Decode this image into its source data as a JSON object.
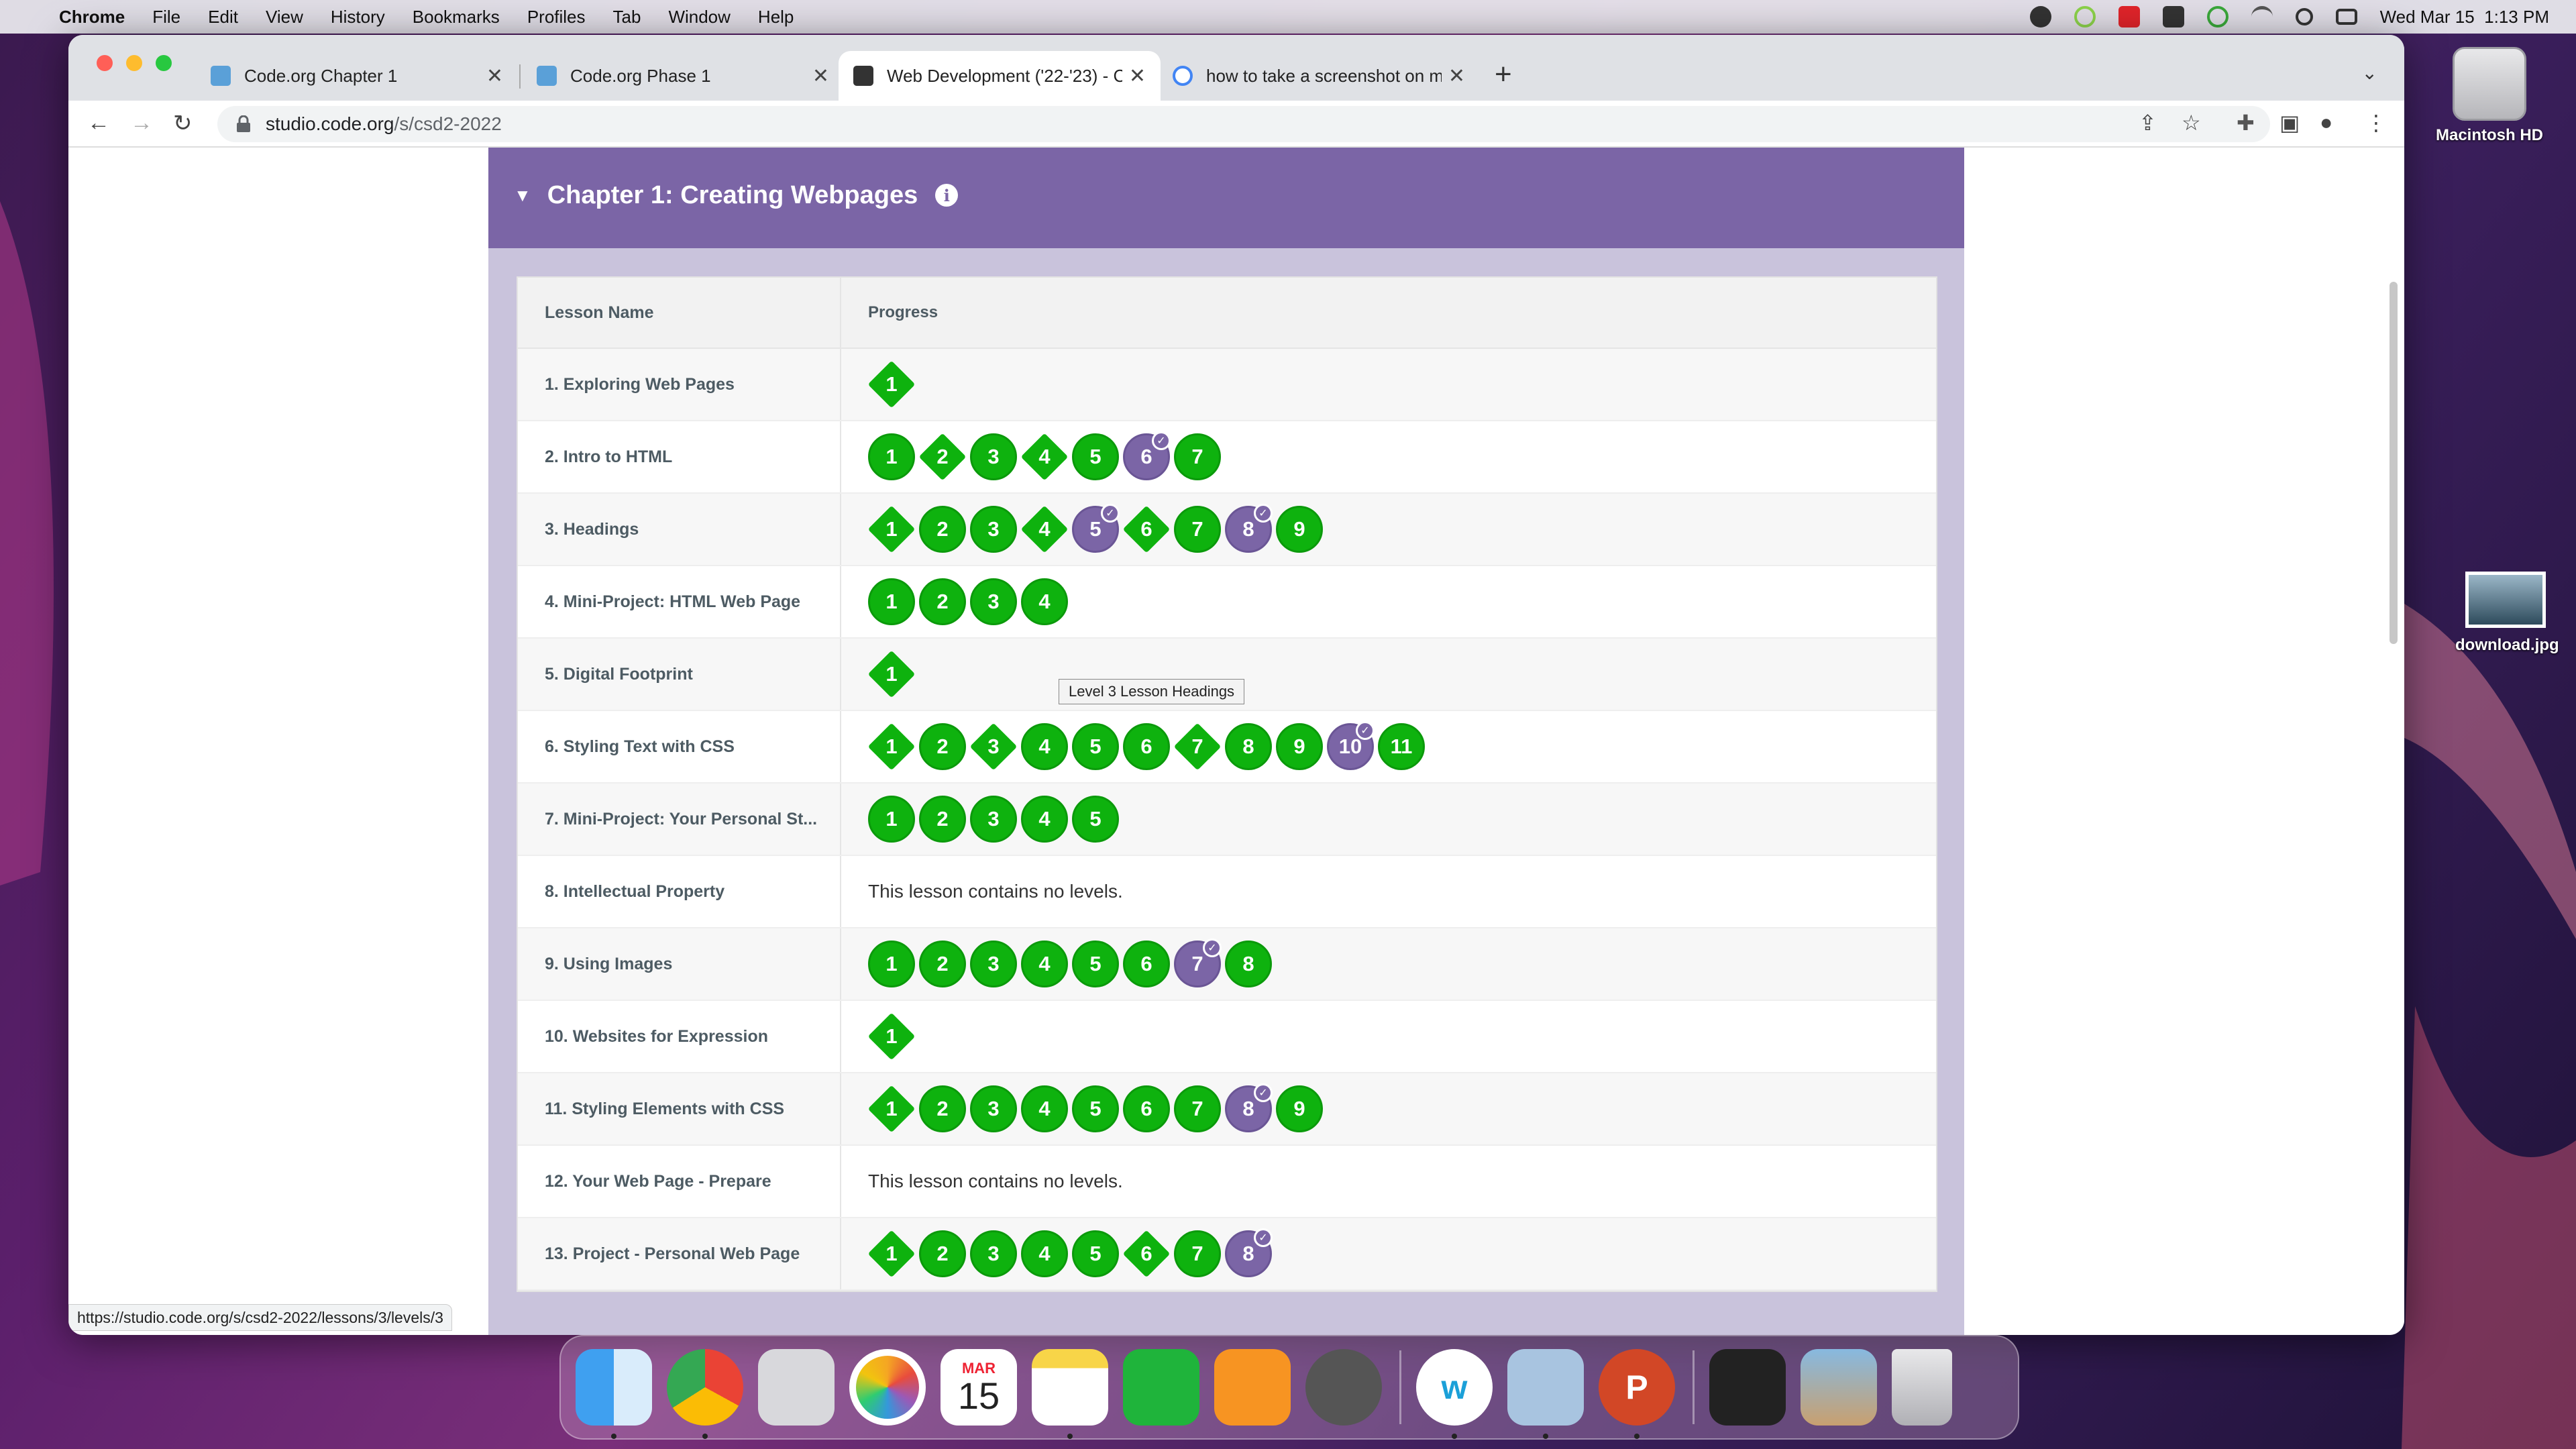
{
  "menubar": {
    "app": "Chrome",
    "items": [
      "File",
      "Edit",
      "View",
      "History",
      "Bookmarks",
      "Profiles",
      "Tab",
      "Window",
      "Help"
    ],
    "clock": "Wed Mar 15  1:13 PM"
  },
  "desktop": {
    "items": [
      {
        "label": "Macintosh HD"
      },
      {
        "label": "download.jpg"
      }
    ]
  },
  "browser": {
    "tabs": [
      {
        "title": "Code.org Chapter 1",
        "active": false
      },
      {
        "title": "Code.org Phase 1",
        "active": false
      },
      {
        "title": "Web Development ('22-'23) - C",
        "active": true
      },
      {
        "title": "how to take a screenshot on m",
        "active": false
      }
    ],
    "url": {
      "host": "studio.code.org",
      "path": "/s/csd2-2022"
    },
    "status_url": "https://studio.code.org/s/csd2-2022/lessons/3/levels/3"
  },
  "chapter": {
    "title": "Chapter 1: Creating Webpages",
    "col_lesson": "Lesson Name",
    "col_progress": "Progress"
  },
  "lessons": [
    {
      "name": "1. Exploring Web Pages",
      "levels": [
        {
          "n": "1",
          "shape": "diamond",
          "state": "done"
        }
      ]
    },
    {
      "name": "2. Intro to HTML",
      "levels": [
        {
          "n": "1",
          "shape": "circle",
          "state": "done"
        },
        {
          "n": "2",
          "shape": "diamond",
          "state": "done"
        },
        {
          "n": "3",
          "shape": "circle",
          "state": "done"
        },
        {
          "n": "4",
          "shape": "diamond",
          "state": "done"
        },
        {
          "n": "5",
          "shape": "circle",
          "state": "done"
        },
        {
          "n": "6",
          "shape": "circle",
          "state": "assessed"
        },
        {
          "n": "7",
          "shape": "circle",
          "state": "done"
        }
      ]
    },
    {
      "name": "3. Headings",
      "levels": [
        {
          "n": "1",
          "shape": "diamond",
          "state": "done"
        },
        {
          "n": "2",
          "shape": "circle",
          "state": "done"
        },
        {
          "n": "3",
          "shape": "circle",
          "state": "done"
        },
        {
          "n": "4",
          "shape": "diamond",
          "state": "done"
        },
        {
          "n": "5",
          "shape": "circle",
          "state": "assessed"
        },
        {
          "n": "6",
          "shape": "diamond",
          "state": "done"
        },
        {
          "n": "7",
          "shape": "circle",
          "state": "done"
        },
        {
          "n": "8",
          "shape": "circle",
          "state": "assessed"
        },
        {
          "n": "9",
          "shape": "circle",
          "state": "done"
        }
      ],
      "tooltip": "Level 3 Lesson Headings"
    },
    {
      "name": "4. Mini-Project: HTML Web Page",
      "levels": [
        {
          "n": "1",
          "shape": "circle",
          "state": "done"
        },
        {
          "n": "2",
          "shape": "circle",
          "state": "done"
        },
        {
          "n": "3",
          "shape": "circle",
          "state": "done"
        },
        {
          "n": "4",
          "shape": "circle",
          "state": "done"
        }
      ]
    },
    {
      "name": "5. Digital Footprint",
      "levels": [
        {
          "n": "1",
          "shape": "diamond",
          "state": "done"
        }
      ]
    },
    {
      "name": "6. Styling Text with CSS",
      "levels": [
        {
          "n": "1",
          "shape": "diamond",
          "state": "done"
        },
        {
          "n": "2",
          "shape": "circle",
          "state": "done"
        },
        {
          "n": "3",
          "shape": "diamond",
          "state": "done"
        },
        {
          "n": "4",
          "shape": "circle",
          "state": "done"
        },
        {
          "n": "5",
          "shape": "circle",
          "state": "done"
        },
        {
          "n": "6",
          "shape": "circle",
          "state": "done"
        },
        {
          "n": "7",
          "shape": "diamond",
          "state": "done"
        },
        {
          "n": "8",
          "shape": "circle",
          "state": "done"
        },
        {
          "n": "9",
          "shape": "circle",
          "state": "done"
        },
        {
          "n": "10",
          "shape": "circle",
          "state": "assessed"
        },
        {
          "n": "11",
          "shape": "circle",
          "state": "done"
        }
      ]
    },
    {
      "name": "7. Mini-Project: Your Personal St...",
      "levels": [
        {
          "n": "1",
          "shape": "circle",
          "state": "done"
        },
        {
          "n": "2",
          "shape": "circle",
          "state": "done"
        },
        {
          "n": "3",
          "shape": "circle",
          "state": "done"
        },
        {
          "n": "4",
          "shape": "circle",
          "state": "done"
        },
        {
          "n": "5",
          "shape": "circle",
          "state": "done"
        }
      ]
    },
    {
      "name": "8. Intellectual Property",
      "levels": [],
      "note": "This lesson contains no levels."
    },
    {
      "name": "9. Using Images",
      "levels": [
        {
          "n": "1",
          "shape": "circle",
          "state": "done"
        },
        {
          "n": "2",
          "shape": "circle",
          "state": "done"
        },
        {
          "n": "3",
          "shape": "circle",
          "state": "done"
        },
        {
          "n": "4",
          "shape": "circle",
          "state": "done"
        },
        {
          "n": "5",
          "shape": "circle",
          "state": "done"
        },
        {
          "n": "6",
          "shape": "circle",
          "state": "done"
        },
        {
          "n": "7",
          "shape": "circle",
          "state": "assessed"
        },
        {
          "n": "8",
          "shape": "circle",
          "state": "done"
        }
      ]
    },
    {
      "name": "10. Websites for Expression",
      "levels": [
        {
          "n": "1",
          "shape": "diamond",
          "state": "done"
        }
      ]
    },
    {
      "name": "11. Styling Elements with CSS",
      "levels": [
        {
          "n": "1",
          "shape": "diamond",
          "state": "done"
        },
        {
          "n": "2",
          "shape": "circle",
          "state": "done"
        },
        {
          "n": "3",
          "shape": "circle",
          "state": "done"
        },
        {
          "n": "4",
          "shape": "circle",
          "state": "done"
        },
        {
          "n": "5",
          "shape": "circle",
          "state": "done"
        },
        {
          "n": "6",
          "shape": "circle",
          "state": "done"
        },
        {
          "n": "7",
          "shape": "circle",
          "state": "done"
        },
        {
          "n": "8",
          "shape": "circle",
          "state": "assessed"
        },
        {
          "n": "9",
          "shape": "circle",
          "state": "done"
        }
      ]
    },
    {
      "name": "12. Your Web Page - Prepare",
      "levels": [],
      "note": "This lesson contains no levels."
    },
    {
      "name": "13. Project - Personal Web Page",
      "levels": [
        {
          "n": "1",
          "shape": "diamond",
          "state": "done"
        },
        {
          "n": "2",
          "shape": "circle",
          "state": "done"
        },
        {
          "n": "3",
          "shape": "circle",
          "state": "done"
        },
        {
          "n": "4",
          "shape": "circle",
          "state": "done"
        },
        {
          "n": "5",
          "shape": "circle",
          "state": "done"
        },
        {
          "n": "6",
          "shape": "diamond",
          "state": "done"
        },
        {
          "n": "7",
          "shape": "circle",
          "state": "done"
        },
        {
          "n": "8",
          "shape": "circle",
          "state": "assessed"
        }
      ]
    }
  ],
  "dock": {
    "calendar_month": "MAR",
    "calendar_day": "15",
    "apps": [
      "finder",
      "chrome",
      "launchpad",
      "photos",
      "calendar",
      "notes",
      "numbers",
      "pages",
      "system-settings",
      "webex",
      "preview",
      "powerpoint",
      "screen",
      "photo",
      "trash"
    ]
  },
  "colors": {
    "done": "#0eb20e",
    "assessed": "#7b65a6",
    "header": "#7b65a6"
  }
}
